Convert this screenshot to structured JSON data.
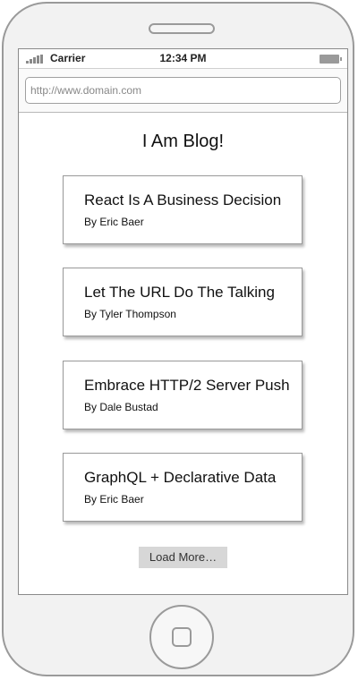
{
  "status_bar": {
    "carrier": "Carrier",
    "time": "12:34 PM"
  },
  "browser": {
    "url": "http://www.domain.com"
  },
  "page": {
    "title": "I Am Blog!",
    "posts": [
      {
        "title": "React Is A Business Decision",
        "author": "By Eric Baer"
      },
      {
        "title": "Let The URL Do The Talking",
        "author": "By Tyler Thompson"
      },
      {
        "title": "Embrace HTTP/2 Server Push",
        "author": "By Dale Bustad"
      },
      {
        "title": "GraphQL + Declarative Data",
        "author": "By Eric Baer"
      }
    ],
    "load_more_label": "Load More…"
  },
  "icons": {
    "signal": "signal-bars-icon",
    "battery": "battery-icon",
    "home": "home-button-icon"
  }
}
